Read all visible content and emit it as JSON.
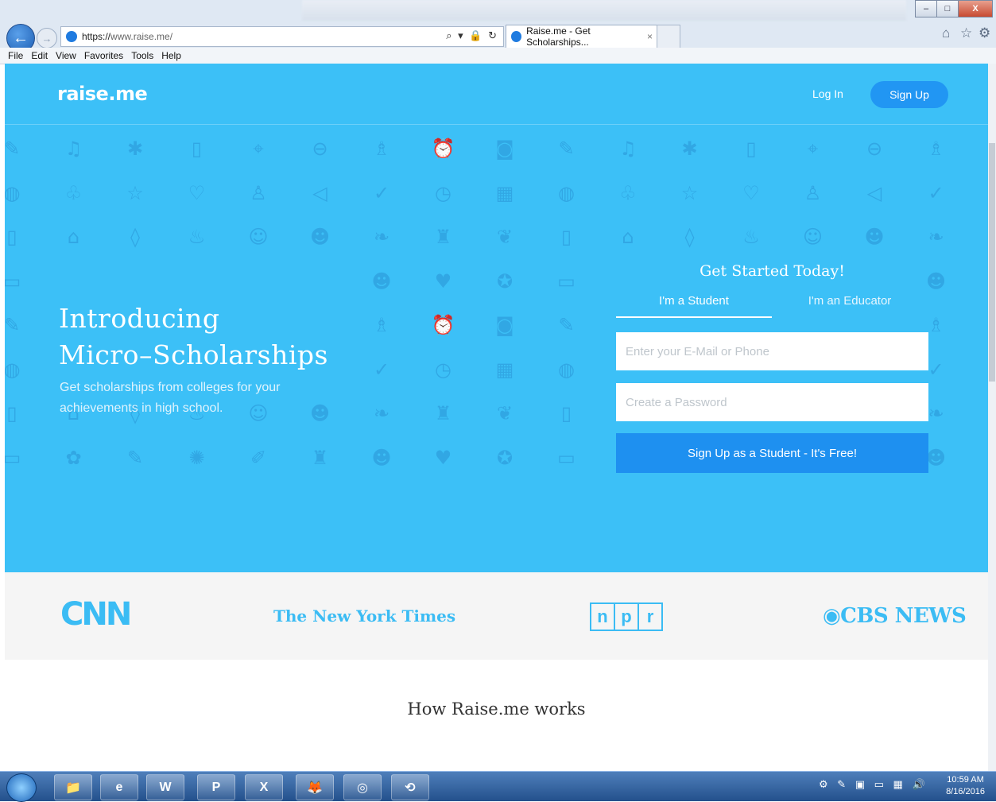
{
  "browser": {
    "url_scheme": "https://",
    "url_host": "www.raise.me/",
    "tab_title": "Raise.me - Get Scholarships...",
    "tab_close": "×",
    "nav_back": "←",
    "nav_forward": "→",
    "address_tools": "⌕ ▾ 🔒 ↻",
    "window_minimize": "–",
    "window_maximize": "□",
    "window_close": "X",
    "home_icon": "⌂",
    "favorites_icon": "☆",
    "settings_icon": "⚙",
    "menu": [
      "File",
      "Edit",
      "View",
      "Favorites",
      "Tools",
      "Help"
    ]
  },
  "header": {
    "logo": "raise.me",
    "login": "Log In",
    "signup": "Sign Up"
  },
  "hero": {
    "title_line1": "Introducing",
    "title_line2": "Micro–Scholarships",
    "subtitle": "Get scholarships from colleges for your achievements in high school."
  },
  "signup_form": {
    "title": "Get Started Today!",
    "tab_student": "I'm a Student",
    "tab_educator": "I'm an Educator",
    "email_placeholder": "Enter your E-Mail or Phone",
    "password_placeholder": "Create a Password",
    "submit": "Sign Up as a Student - It's Free!"
  },
  "press": {
    "cnn": "CNN",
    "nyt": "The New York Times",
    "npr": [
      "n",
      "p",
      "r"
    ],
    "cbs": "◉CBS NEWS"
  },
  "how_it_works": "How Raise.me works",
  "taskbar": {
    "apps": [
      "📁",
      "e",
      "W",
      "P",
      "X",
      "🦊",
      "◎",
      "⟲"
    ],
    "tray_icons": "⚙ ✎ ▣ ▭ ▦ 🔊",
    "time": "10:59 AM",
    "date": "8/16/2016"
  },
  "colors": {
    "hero_bg": "#3cc0f7",
    "button_blue": "#1e90f0",
    "press_logo": "#3bbcf4",
    "pattern_icon": "#31a7e4"
  },
  "pattern_icons": [
    "✎",
    "♫",
    "✱",
    "▯",
    "⌖",
    "⊖",
    "♗",
    "⏰",
    "◙",
    "✎",
    "♫",
    "✱",
    "▯",
    "⌖",
    "⊖",
    "♗",
    "◍",
    "♧",
    "☆",
    "♡",
    "♙",
    "◁",
    "✓",
    "◷",
    "▦",
    "◍",
    "♧",
    "☆",
    "♡",
    "♙",
    "◁",
    "✓",
    "▯",
    "⌂",
    "◊",
    "♨",
    "☺",
    "☻",
    "❧",
    "♜",
    "❦",
    "▯",
    "⌂",
    "◊",
    "♨",
    "☺",
    "☻",
    "❧",
    "▭",
    "✿",
    "✎",
    "✺",
    "✐",
    "♜",
    "☻",
    "♥",
    "✪",
    "▭",
    "✿",
    "✎",
    "✺",
    "✐",
    "♜",
    "☻"
  ]
}
